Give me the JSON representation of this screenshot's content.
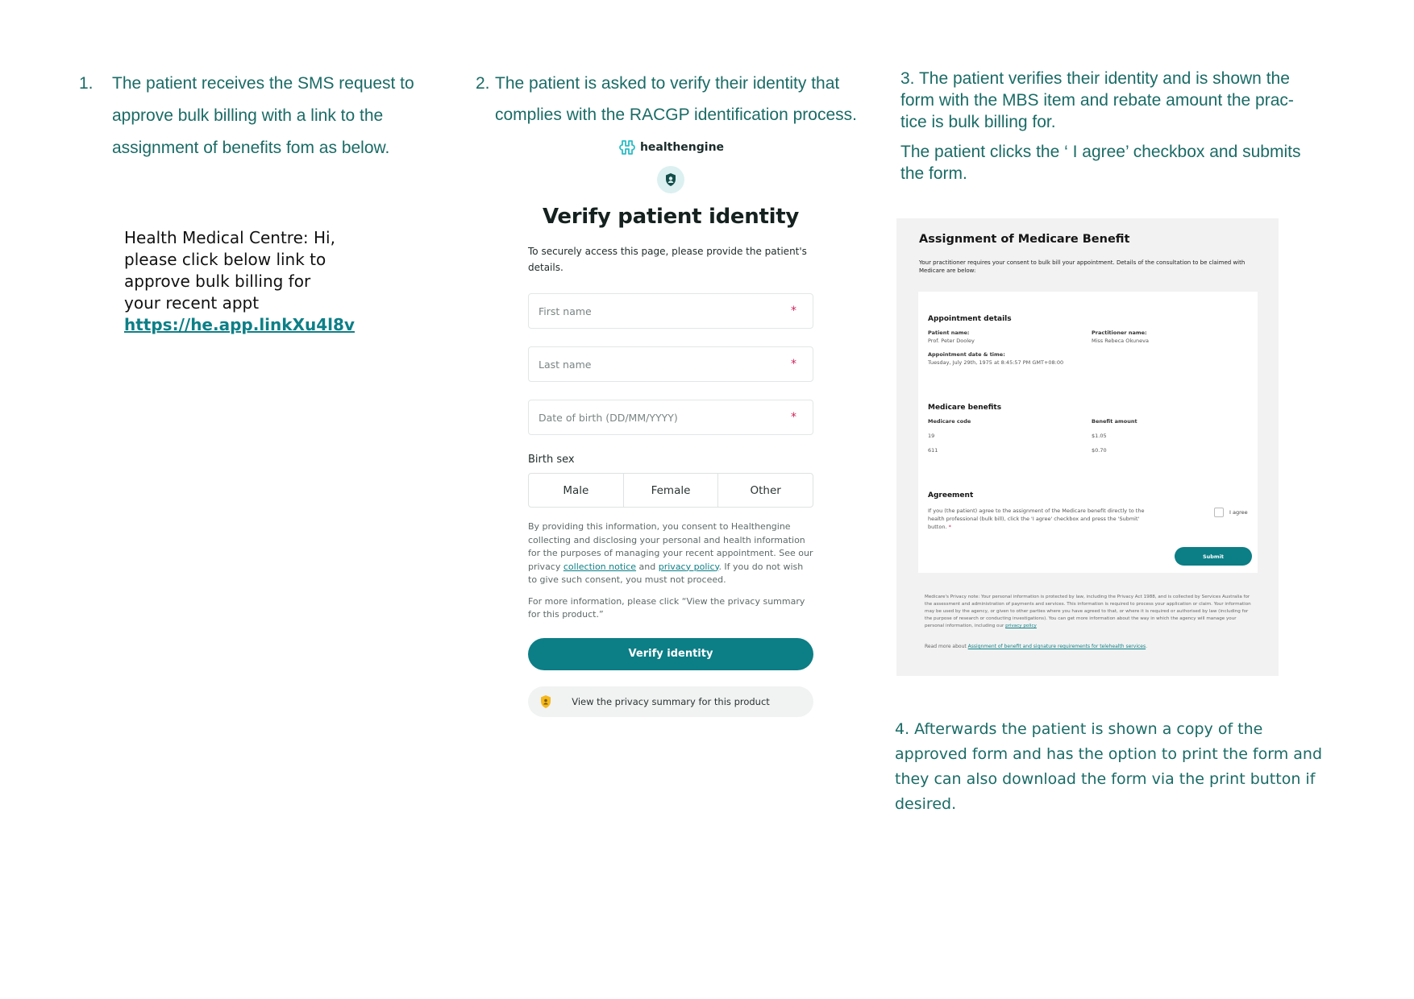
{
  "steps": {
    "step1": {
      "number": "1.",
      "text": "The patient receives the SMS request to approve bulk billing with a link to the assignment of benefits fom as below."
    },
    "step2": {
      "number": "2.",
      "text": "The patient is asked to verify their identity that complies with the RACGP identification process."
    },
    "step3": {
      "text": "3. The patient verifies their identity and is shown the form with the MBS item and rebate amount the prac-tice is bulk billing for.",
      "text2": "The patient clicks the ‘ I agree’ checkbox and submits the form."
    },
    "step4": {
      "text": "4. Afterwards the patient is shown a copy of the approved form and has  the option to print the form and they can also download the form via the print button if desired."
    }
  },
  "sms": {
    "message": "Health Medical Centre: Hi, please click below link to approve bulk billing for your recent appt ",
    "link": "https://he.app.linkXu4l8v"
  },
  "verify": {
    "brand": "healthengine",
    "title": "Verify patient identity",
    "intro": "To securely access this page, please provide the patient's details.",
    "fields": [
      {
        "placeholder": "First name",
        "required": "*"
      },
      {
        "placeholder": "Last name",
        "required": "*"
      },
      {
        "placeholder": "Date of birth (DD/MM/YYYY)",
        "required": "*"
      }
    ],
    "birth_sex_label": "Birth sex",
    "birth_sex_options": [
      "Male",
      "Female",
      "Other"
    ],
    "consent_pre": "By providing this information, you consent to Healthengine collecting and disclosing your personal and health information for the purposes of managing your recent appointment. See our privacy ",
    "consent_link1": "collection notice",
    "consent_mid": " and ",
    "consent_link2": "privacy policy",
    "consent_post": ". If you do not wish to give such consent, you must not proceed.",
    "more_info": "For more information, please click “View the privacy summary for this product.”",
    "verify_button": "Verify identity",
    "privacy_button": "View the privacy summary for this product"
  },
  "medicare": {
    "title": "Assignment of Medicare Benefit",
    "intro": "Your practitioner requires your consent to bulk bill your appointment. Details of the consultation to be claimed with Medicare are below:",
    "appointment_heading": "Appointment details",
    "patient_name_label": "Patient name:",
    "patient_name": "Prof. Peter Dooley",
    "practitioner_label": "Practitioner name:",
    "practitioner_name": "Miss Rebeca Okuneva",
    "datetime_label": "Appointment date & time:",
    "datetime": "Tuesday, July 29th, 1975 at 8:45:57 PM GMT+08:00",
    "benefits_heading": "Medicare benefits",
    "code_label": "Medicare code",
    "amount_label": "Benefit amount",
    "benefits": [
      {
        "code": "19",
        "amount": "$1.05"
      },
      {
        "code": "611",
        "amount": "$0.70"
      }
    ],
    "agreement_heading": "Agreement",
    "agreement_text": "If you (the patient) agree to the assignment of the Medicare benefit directly to the health professional (bulk bill), click the 'I agree' checkbox and press the 'Submit' button.",
    "agreement_star": "*",
    "agree_label": "I agree",
    "submit_label": "Submit",
    "privacy_note": "Medicare's Privacy note: Your personal information is protected by law, including the Privacy Act 1988, and is collected by Services Australia for the assessment and administration of payments and services. This information is required to process your application or claim. Your information may be used by the agency, or given to other parties where you have agreed to that, or where it is required or authorised by law (including for the purpose of research or conducting investigations). You can get more information about the way in which the agency will manage your personal information, including our ",
    "privacy_note_link": "privacy policy",
    "read_more_pre": "Read more about ",
    "read_more_link": "Assignment of benefit and signature requirements for telehealth services",
    "read_more_post": "."
  }
}
